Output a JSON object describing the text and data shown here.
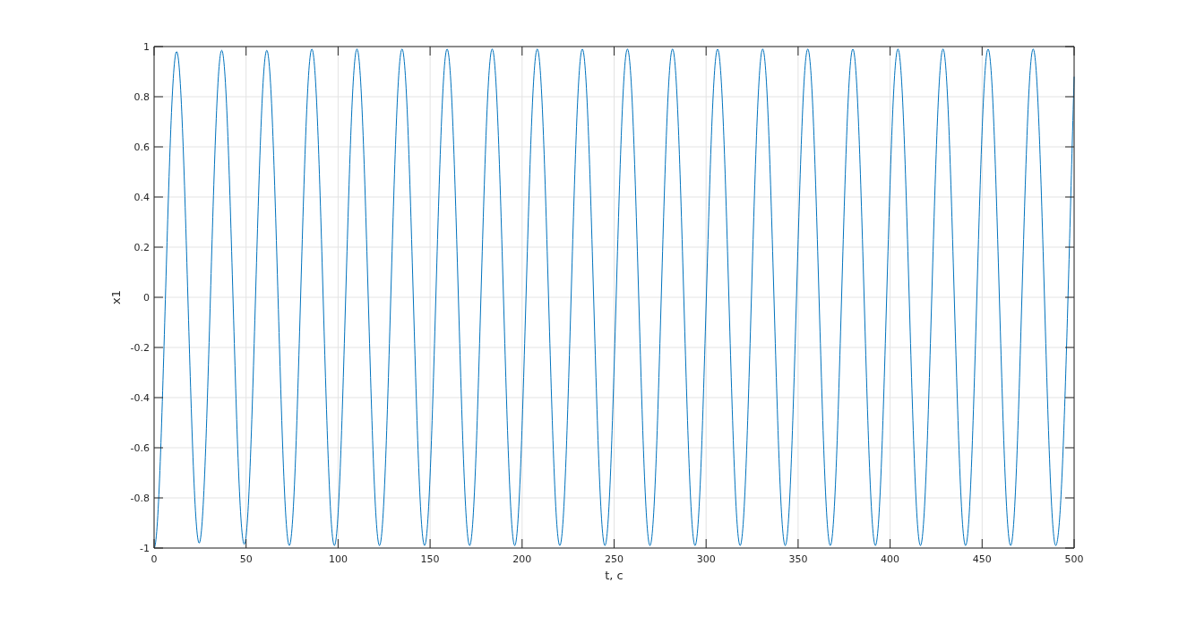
{
  "figure": {
    "chart_data": {
      "type": "line",
      "grid": true,
      "xlabel": "t, c",
      "ylabel": "x1",
      "xlim": [
        0,
        500
      ],
      "ylim": [
        -1,
        1
      ],
      "xticks": [
        0,
        50,
        100,
        150,
        200,
        250,
        300,
        350,
        400,
        450,
        500
      ],
      "yticks": [
        -1,
        -0.8,
        -0.6,
        -0.4,
        -0.2,
        0,
        0.2,
        0.4,
        0.6,
        0.8,
        1
      ],
      "x": [
        0,
        12.25,
        24.5,
        36.75,
        49,
        61.25,
        73.5,
        85.75,
        98,
        110.25,
        122.5,
        134.75,
        147,
        159.25,
        171.5,
        183.75,
        196,
        208.25,
        220.5,
        232.75,
        245,
        257.25,
        269.5,
        281.75,
        294,
        306.25,
        318.5,
        330.75,
        343,
        355.25,
        367.5,
        379.75,
        392,
        404.25,
        416.5,
        428.75,
        441,
        453.25,
        465.5,
        477.75,
        490,
        500
      ],
      "series": [
        {
          "color": "#0072bd",
          "values": [
            -1,
            0.98,
            -0.98,
            0.985,
            -0.985,
            0.985,
            -0.99,
            0.99,
            -0.99,
            0.99,
            -0.99,
            0.99,
            -0.99,
            0.99,
            -0.99,
            0.99,
            -0.99,
            0.99,
            -0.99,
            0.99,
            -0.99,
            0.99,
            -0.99,
            0.99,
            -0.99,
            0.99,
            -0.99,
            0.99,
            -0.99,
            0.99,
            -0.99,
            0.99,
            -0.99,
            0.99,
            -0.99,
            0.99,
            -0.99,
            0.99,
            -0.99,
            0.99,
            -0.99,
            0.88
          ]
        }
      ]
    }
  }
}
